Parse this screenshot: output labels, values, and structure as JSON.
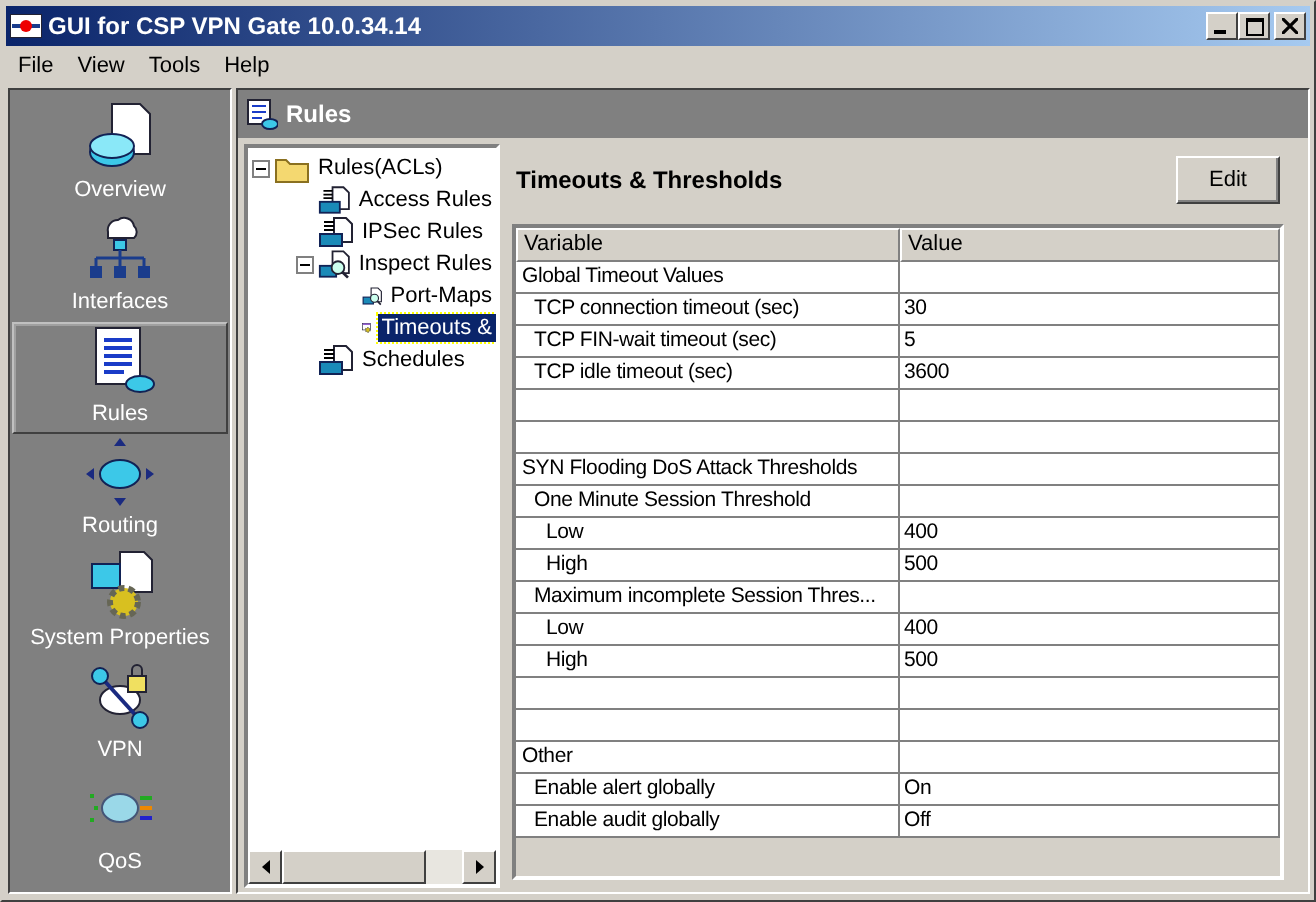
{
  "window": {
    "title": "GUI for CSP VPN Gate 10.0.34.14"
  },
  "menu": [
    "File",
    "View",
    "Tools",
    "Help"
  ],
  "sidebar": {
    "items": [
      {
        "label": "Overview",
        "selected": false
      },
      {
        "label": "Interfaces",
        "selected": false
      },
      {
        "label": "Rules",
        "selected": true
      },
      {
        "label": "Routing",
        "selected": false
      },
      {
        "label": "System Properties",
        "selected": false
      },
      {
        "label": "VPN",
        "selected": false
      },
      {
        "label": "QoS",
        "selected": false
      }
    ]
  },
  "panel": {
    "title": "Rules"
  },
  "tree": {
    "items": [
      {
        "label": "Rules(ACLs)",
        "kind": "folder",
        "expanded": true,
        "selected": false,
        "children": [
          {
            "label": "Access Rules",
            "kind": "rules",
            "selected": false
          },
          {
            "label": "IPSec Rules",
            "kind": "rules",
            "selected": false
          },
          {
            "label": "Inspect Rules",
            "kind": "inspect",
            "expanded": true,
            "selected": false,
            "children": [
              {
                "label": "Port-Maps",
                "kind": "inspect",
                "selected": false
              },
              {
                "label": "Timeouts &",
                "kind": "settings",
                "selected": true
              }
            ]
          },
          {
            "label": "Schedules",
            "kind": "rules",
            "selected": false
          }
        ]
      }
    ]
  },
  "content": {
    "title": "Timeouts & Thresholds",
    "edit_button": "Edit"
  },
  "table": {
    "columns": [
      "Variable",
      "Value"
    ],
    "rows": [
      {
        "kind": "group",
        "variable": "Global Timeout Values",
        "children": [
          {
            "kind": "setting",
            "variable": "TCP connection timeout (sec)",
            "value": "30"
          },
          {
            "kind": "setting",
            "variable": "TCP FIN-wait timeout (sec)",
            "value": "5"
          },
          {
            "kind": "setting",
            "variable": "TCP idle timeout (sec)",
            "value": "3600"
          }
        ]
      },
      {
        "kind": "blank"
      },
      {
        "kind": "blank"
      },
      {
        "kind": "group",
        "variable": "SYN Flooding DoS Attack Thresholds",
        "children": [
          {
            "kind": "group",
            "variable": "One Minute Session Threshold",
            "children": [
              {
                "kind": "setting",
                "variable": "Low",
                "value": "400"
              },
              {
                "kind": "setting",
                "variable": "High",
                "value": "500"
              }
            ]
          },
          {
            "kind": "group",
            "variable": "Maximum incomplete Session Thres...",
            "children": [
              {
                "kind": "setting",
                "variable": "Low",
                "value": "400"
              },
              {
                "kind": "setting",
                "variable": "High",
                "value": "500"
              }
            ]
          }
        ]
      },
      {
        "kind": "blank"
      },
      {
        "kind": "blank"
      },
      {
        "kind": "group",
        "variable": "Other",
        "children": [
          {
            "kind": "setting",
            "variable": "Enable alert globally",
            "value": "On"
          },
          {
            "kind": "setting",
            "variable": "Enable audit globally",
            "value": "Off"
          }
        ]
      }
    ]
  }
}
